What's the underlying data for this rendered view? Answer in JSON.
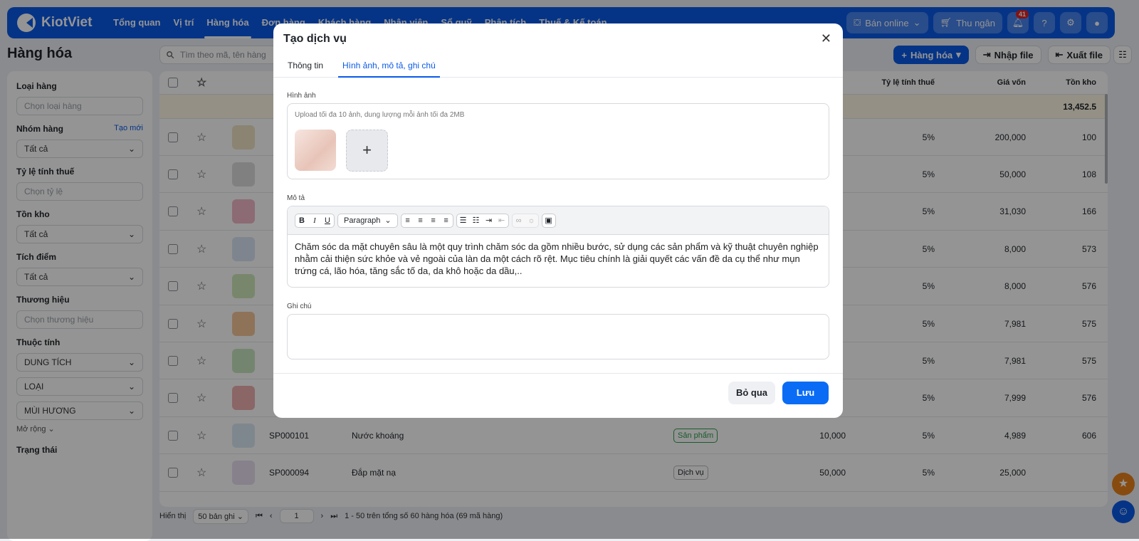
{
  "app": {
    "logo": "KiotViet",
    "nav": [
      "Tổng quan",
      "Vị trí",
      "Hàng hóa",
      "Đơn hàng",
      "Khách hàng",
      "Nhân viên",
      "Sổ quỹ",
      "Phân tích",
      "Thuế & Kế toán"
    ],
    "online": "Bán online",
    "cashier": "Thu ngân",
    "notifications": "41"
  },
  "page": {
    "title": "Hàng hóa",
    "search_placeholder": "Tìm theo mã, tên hàng",
    "add": "Hàng hóa",
    "import": "Nhập file",
    "export": "Xuất file"
  },
  "sidebar": {
    "category": {
      "label": "Loại hàng",
      "placeholder": "Chọn loại hàng"
    },
    "group": {
      "label": "Nhóm hàng",
      "link": "Tạo mới",
      "value": "Tất cả"
    },
    "tax": {
      "label": "Tỷ lệ tính thuế",
      "placeholder": "Chọn tỷ lệ"
    },
    "stock": {
      "label": "Tồn kho",
      "value": "Tất cả"
    },
    "points": {
      "label": "Tích điểm",
      "value": "Tất cả"
    },
    "brand": {
      "label": "Thương hiệu",
      "placeholder": "Chọn thương hiệu"
    },
    "attr": {
      "label": "Thuộc tính",
      "values": [
        "DUNG TÍCH",
        "LOẠI",
        "MÙI HƯƠNG"
      ],
      "more": "Mở rộng"
    },
    "status": {
      "label": "Trạng thái"
    }
  },
  "table": {
    "headers": {
      "tax": "Tỷ lệ tính thuế",
      "cost": "Giá vốn",
      "stock": "Tồn kho"
    },
    "total_stock": "13,452.5",
    "rows": [
      {
        "tax": "5%",
        "cost": "200,000",
        "stock": "100"
      },
      {
        "tax": "5%",
        "cost": "50,000",
        "stock": "108"
      },
      {
        "tax": "5%",
        "cost": "31,030",
        "stock": "166"
      },
      {
        "tax": "5%",
        "cost": "8,000",
        "stock": "573"
      },
      {
        "tax": "5%",
        "cost": "8,000",
        "stock": "576"
      },
      {
        "tax": "5%",
        "cost": "7,981",
        "stock": "575"
      },
      {
        "tax": "5%",
        "cost": "7,981",
        "stock": "575"
      },
      {
        "tax": "5%",
        "cost": "7,999",
        "stock": "576"
      },
      {
        "code": "SP000101",
        "name": "Nước khoáng",
        "type": "Sản phẩm",
        "price": "10,000",
        "tax": "5%",
        "cost": "4,989",
        "stock": "606"
      },
      {
        "code": "SP000094",
        "name": "Đắp mặt nạ",
        "type": "Dịch vụ",
        "price": "50,000",
        "tax": "5%",
        "cost": "25,000",
        "stock": ""
      }
    ]
  },
  "pager": {
    "label": "Hiển thị",
    "size": "50 bản ghi",
    "page": "1",
    "summary": "1 - 50 trên tổng số 60 hàng hóa (69 mã hàng)"
  },
  "modal": {
    "title": "Tạo dịch vụ",
    "tabs": [
      "Thông tin",
      "Hình ảnh, mô tả, ghi chú"
    ],
    "image_label": "Hình ảnh",
    "image_hint": "Upload tối đa 10 ảnh, dung lượng mỗi ảnh tối đa 2MB",
    "desc_label": "Mô tả",
    "format": "Paragraph",
    "description": "Chăm sóc da mặt chuyên sâu là một quy trình chăm sóc da gồm nhiều bước, sử dụng các sản phẩm và kỹ thuật chuyên nghiệp nhằm cải thiện sức khỏe và vẻ ngoài của làn da một cách rõ rệt. Mục tiêu chính là giải quyết các vấn đề da cụ thể như mụn trứng cá, lão hóa, tăng sắc tố da, da khô hoặc da dầu,..",
    "note_label": "Ghi chú",
    "note_value": "",
    "cancel": "Bỏ qua",
    "save": "Lưu"
  }
}
